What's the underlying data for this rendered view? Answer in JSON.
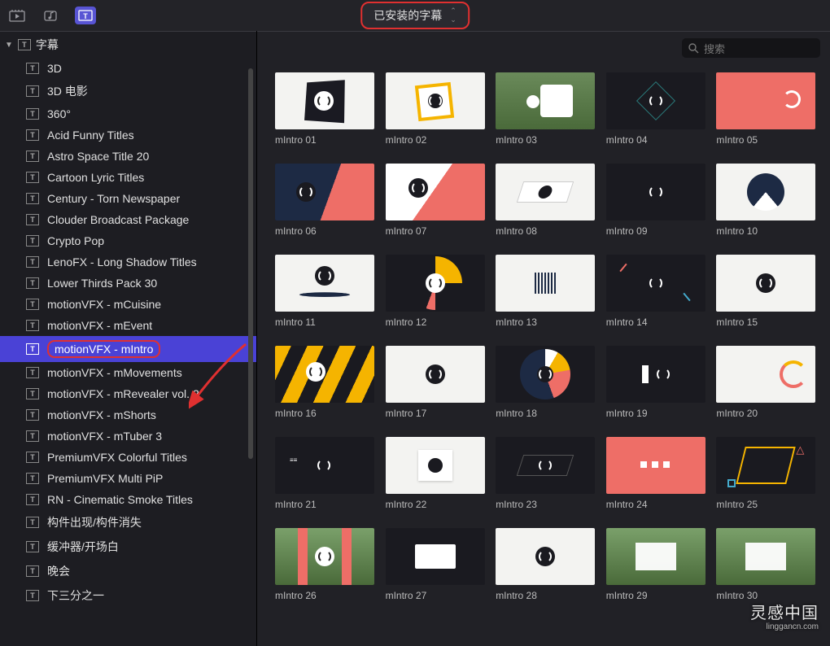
{
  "topbar": {
    "dropdown_label": "已安装的字幕"
  },
  "search": {
    "placeholder": "搜索"
  },
  "sidebar": {
    "root_label": "字幕",
    "items": [
      {
        "label": "3D"
      },
      {
        "label": "3D 电影"
      },
      {
        "label": "360°"
      },
      {
        "label": "Acid Funny Titles"
      },
      {
        "label": "Astro Space Title 20"
      },
      {
        "label": "Cartoon Lyric Titles"
      },
      {
        "label": "Century - Torn Newspaper"
      },
      {
        "label": "Clouder Broadcast Package"
      },
      {
        "label": "Crypto Pop"
      },
      {
        "label": "LenoFX - Long Shadow Titles"
      },
      {
        "label": "Lower Thirds Pack 30"
      },
      {
        "label": "motionVFX - mCuisine"
      },
      {
        "label": "motionVFX - mEvent"
      },
      {
        "label": "motionVFX - mIntro",
        "selected": true,
        "highlighted": true
      },
      {
        "label": "motionVFX - mMovements"
      },
      {
        "label": "motionVFX - mRevealer vol. 2"
      },
      {
        "label": "motionVFX - mShorts"
      },
      {
        "label": "motionVFX - mTuber 3"
      },
      {
        "label": "PremiumVFX Colorful Titles"
      },
      {
        "label": "PremiumVFX Multi PiP"
      },
      {
        "label": "RN - Cinematic Smoke Titles"
      },
      {
        "label": "构件出现/构件消失"
      },
      {
        "label": "缓冲器/开场白"
      },
      {
        "label": "晚会"
      },
      {
        "label": "下三分之一"
      }
    ]
  },
  "grid": {
    "items": [
      {
        "label": "mIntro 01"
      },
      {
        "label": "mIntro 02"
      },
      {
        "label": "mIntro 03"
      },
      {
        "label": "mIntro 04"
      },
      {
        "label": "mIntro 05"
      },
      {
        "label": "mIntro 06"
      },
      {
        "label": "mIntro 07"
      },
      {
        "label": "mIntro 08"
      },
      {
        "label": "mIntro 09"
      },
      {
        "label": "mIntro 10"
      },
      {
        "label": "mIntro 11"
      },
      {
        "label": "mIntro 12"
      },
      {
        "label": "mIntro 13"
      },
      {
        "label": "mIntro 14"
      },
      {
        "label": "mIntro 15"
      },
      {
        "label": "mIntro 16"
      },
      {
        "label": "mIntro 17"
      },
      {
        "label": "mIntro 18"
      },
      {
        "label": "mIntro 19"
      },
      {
        "label": "mIntro 20"
      },
      {
        "label": "mIntro 21"
      },
      {
        "label": "mIntro 22"
      },
      {
        "label": "mIntro 23"
      },
      {
        "label": "mIntro 24"
      },
      {
        "label": "mIntro 25"
      },
      {
        "label": "mIntro 26"
      },
      {
        "label": "mIntro 27"
      },
      {
        "label": "mIntro 28"
      },
      {
        "label": "mIntro 29"
      },
      {
        "label": "mIntro 30"
      }
    ]
  },
  "watermark": {
    "big": "灵感中国",
    "small": "linggancn.com"
  },
  "colors": {
    "accent": "#5854d4",
    "annotation_red": "#e03030",
    "coral": "#ee6e67",
    "yellow": "#f5b400",
    "navy": "#1d2a44"
  }
}
